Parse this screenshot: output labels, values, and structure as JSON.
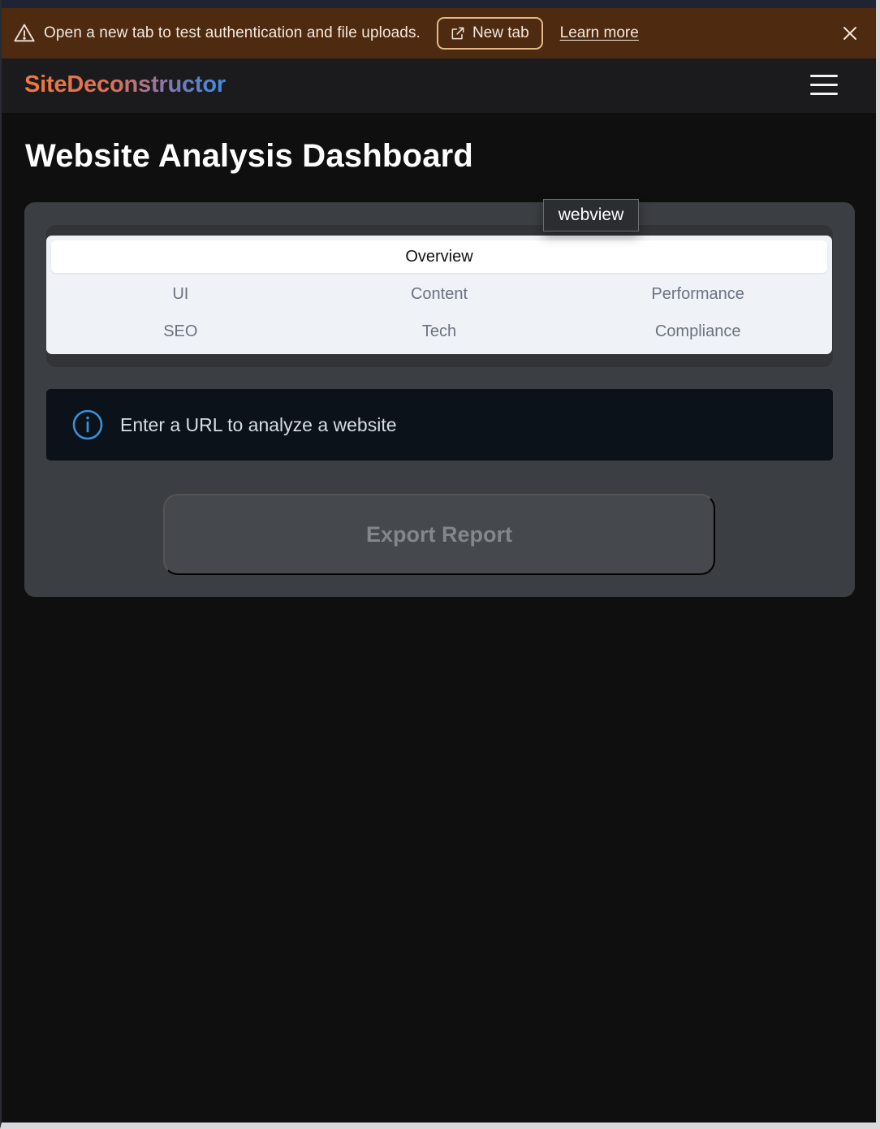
{
  "banner": {
    "message": "Open a new tab to test authentication and file uploads.",
    "new_tab_label": "New tab",
    "learn_more_label": "Learn more",
    "warning_icon": "warning-triangle-icon",
    "external_icon": "external-link-icon",
    "close_icon": "close-icon"
  },
  "header": {
    "logo_text": "SiteDeconstructor",
    "menu_icon": "hamburger-menu-icon"
  },
  "page": {
    "title": "Website Analysis Dashboard"
  },
  "tabs": {
    "active": "Overview",
    "items": [
      "UI",
      "Content",
      "Performance",
      "SEO",
      "Tech",
      "Compliance"
    ]
  },
  "info": {
    "icon": "info-circle-icon",
    "text": "Enter a URL to analyze a website"
  },
  "actions": {
    "export_label": "Export Report"
  },
  "tooltip": {
    "text": "webview"
  },
  "colors": {
    "banner_bg": "#4e2a10",
    "page_bg": "#0f0f10",
    "card_bg": "#3b3e42",
    "info_accent": "#3b8fd6",
    "logo_start": "#f07a3c",
    "logo_end": "#3a8de0"
  }
}
